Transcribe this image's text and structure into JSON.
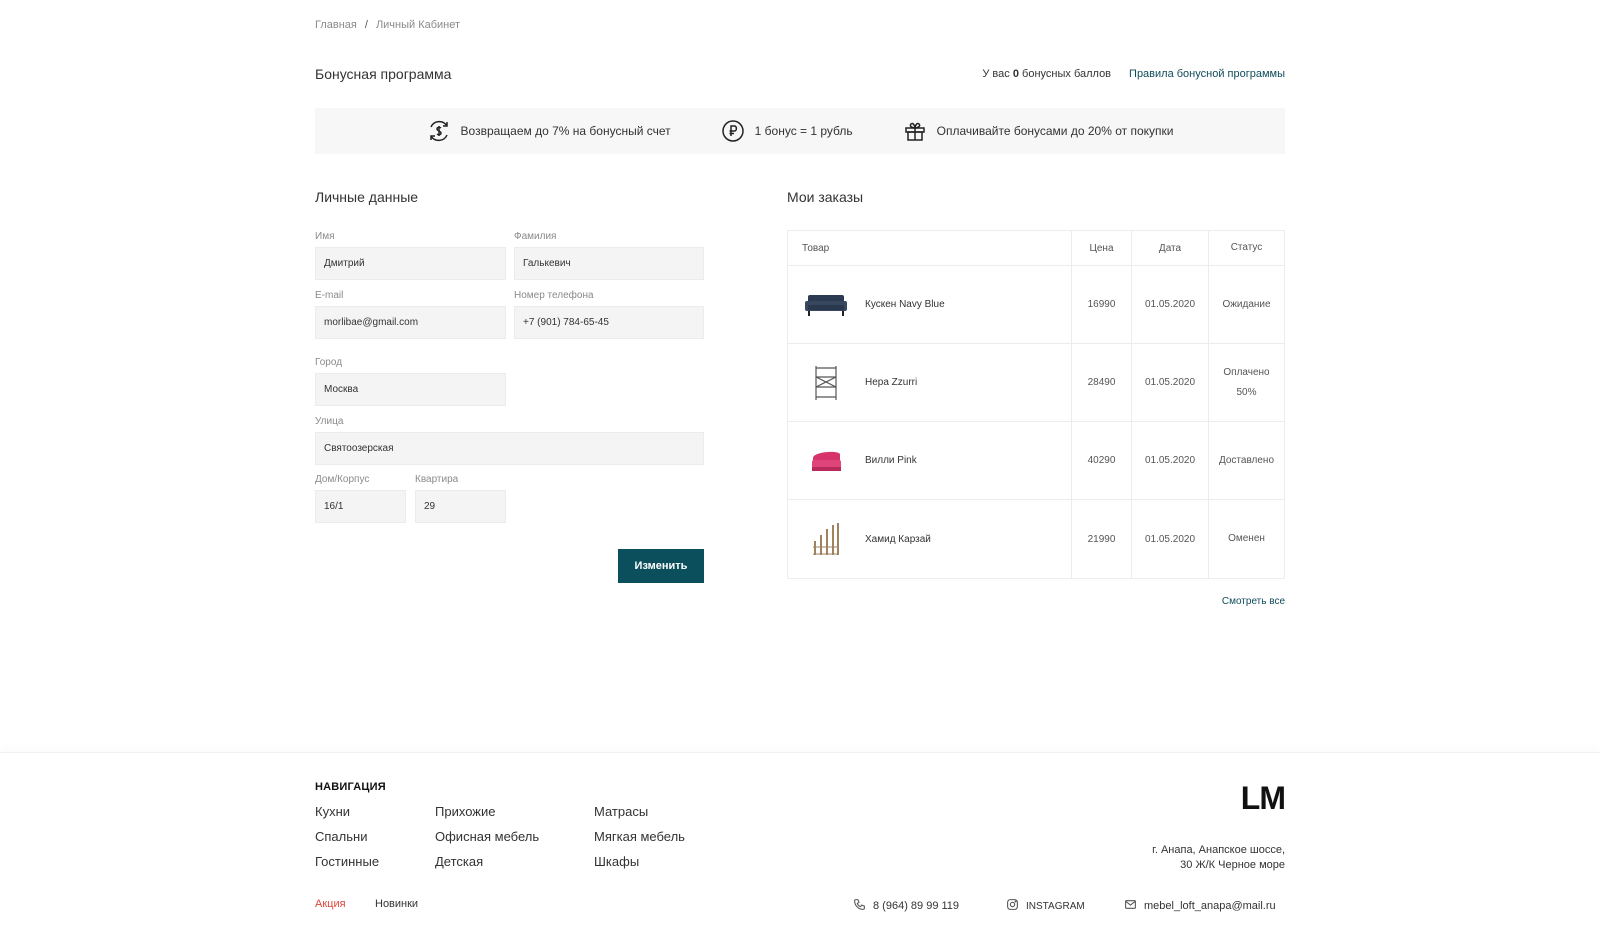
{
  "breadcrumb": {
    "home": "Главная",
    "separator": "/",
    "current": "Личный Кабинет"
  },
  "bonus": {
    "title": "Бонусная программа",
    "balance_prefix": "У вас",
    "balance_value": "0",
    "balance_suffix": "бонусных баллов",
    "rules_link": "Правила бонусной программы",
    "features": [
      {
        "icon": "cashback-icon",
        "text": "Возвращаем до 7% на бонусный счет"
      },
      {
        "icon": "ruble-icon",
        "text": "1 бонус = 1 рубль"
      },
      {
        "icon": "gift-icon",
        "text": "Оплачивайте бонусами до 20% от покупки"
      }
    ]
  },
  "personal": {
    "title": "Личные данные",
    "first_name": {
      "label": "Имя",
      "value": "Дмитрий"
    },
    "last_name": {
      "label": "Фамилия",
      "value": "Галькевич"
    },
    "email": {
      "label": "E-mail",
      "value": "morlibae@gmail.com"
    },
    "phone": {
      "label": "Номер телефона",
      "value": "+7 (901) 784-65-45"
    },
    "city": {
      "label": "Город",
      "value": "Москва"
    },
    "street": {
      "label": "Улица",
      "value": "Святоозерская"
    },
    "house": {
      "label": "Дом/Корпус",
      "value": "16/1"
    },
    "apartment": {
      "label": "Квартира",
      "value": "29"
    },
    "submit_label": "Изменить"
  },
  "orders": {
    "title": "Мои заказы",
    "headers": {
      "product": "Товар",
      "price": "Цена",
      "date": "Дата",
      "status": "Статус"
    },
    "rows": [
      {
        "product": "Кускен Navy Blue",
        "price": "16990",
        "date": "01.05.2020",
        "status": "Ожидание",
        "thumb": "sofa-navy-icon"
      },
      {
        "product": "Нера Zzurri",
        "price": "28490",
        "date": "01.05.2020",
        "status": "Оплачено 50%",
        "thumb": "shelf-icon"
      },
      {
        "product": "Вилли Pink",
        "price": "40290",
        "date": "01.05.2020",
        "status": "Доставлено",
        "thumb": "pink-sofa-icon"
      },
      {
        "product": "Хамид Карзай",
        "price": "21990",
        "date": "01.05.2020",
        "status": "Оменен",
        "thumb": "wood-rack-icon"
      }
    ],
    "see_all": "Смотреть все"
  },
  "footer": {
    "nav_title": "НАВИГАЦИЯ",
    "col1": [
      "Кухни",
      "Спальни",
      "Гостинные"
    ],
    "col2": [
      "Прихожие",
      "Офисная мебель",
      "Детская"
    ],
    "col3": [
      "Матрасы",
      "Мягкая мебель",
      "Шкафы"
    ],
    "promo": "Акция",
    "new": "Новинки",
    "logo": "LM",
    "address_line1": "г. Анапа, Анапское шоссе,",
    "address_line2": "30 Ж/К Черное море",
    "phone": "8 (964) 89 99 119",
    "instagram": "INSTAGRAM",
    "email": "mebel_loft_anapa@mail.ru"
  },
  "colors": {
    "accent": "#0b4f5c",
    "promo": "#e0443b",
    "field_bg": "#f4f4f4",
    "strip_bg": "#f7f7f7"
  }
}
